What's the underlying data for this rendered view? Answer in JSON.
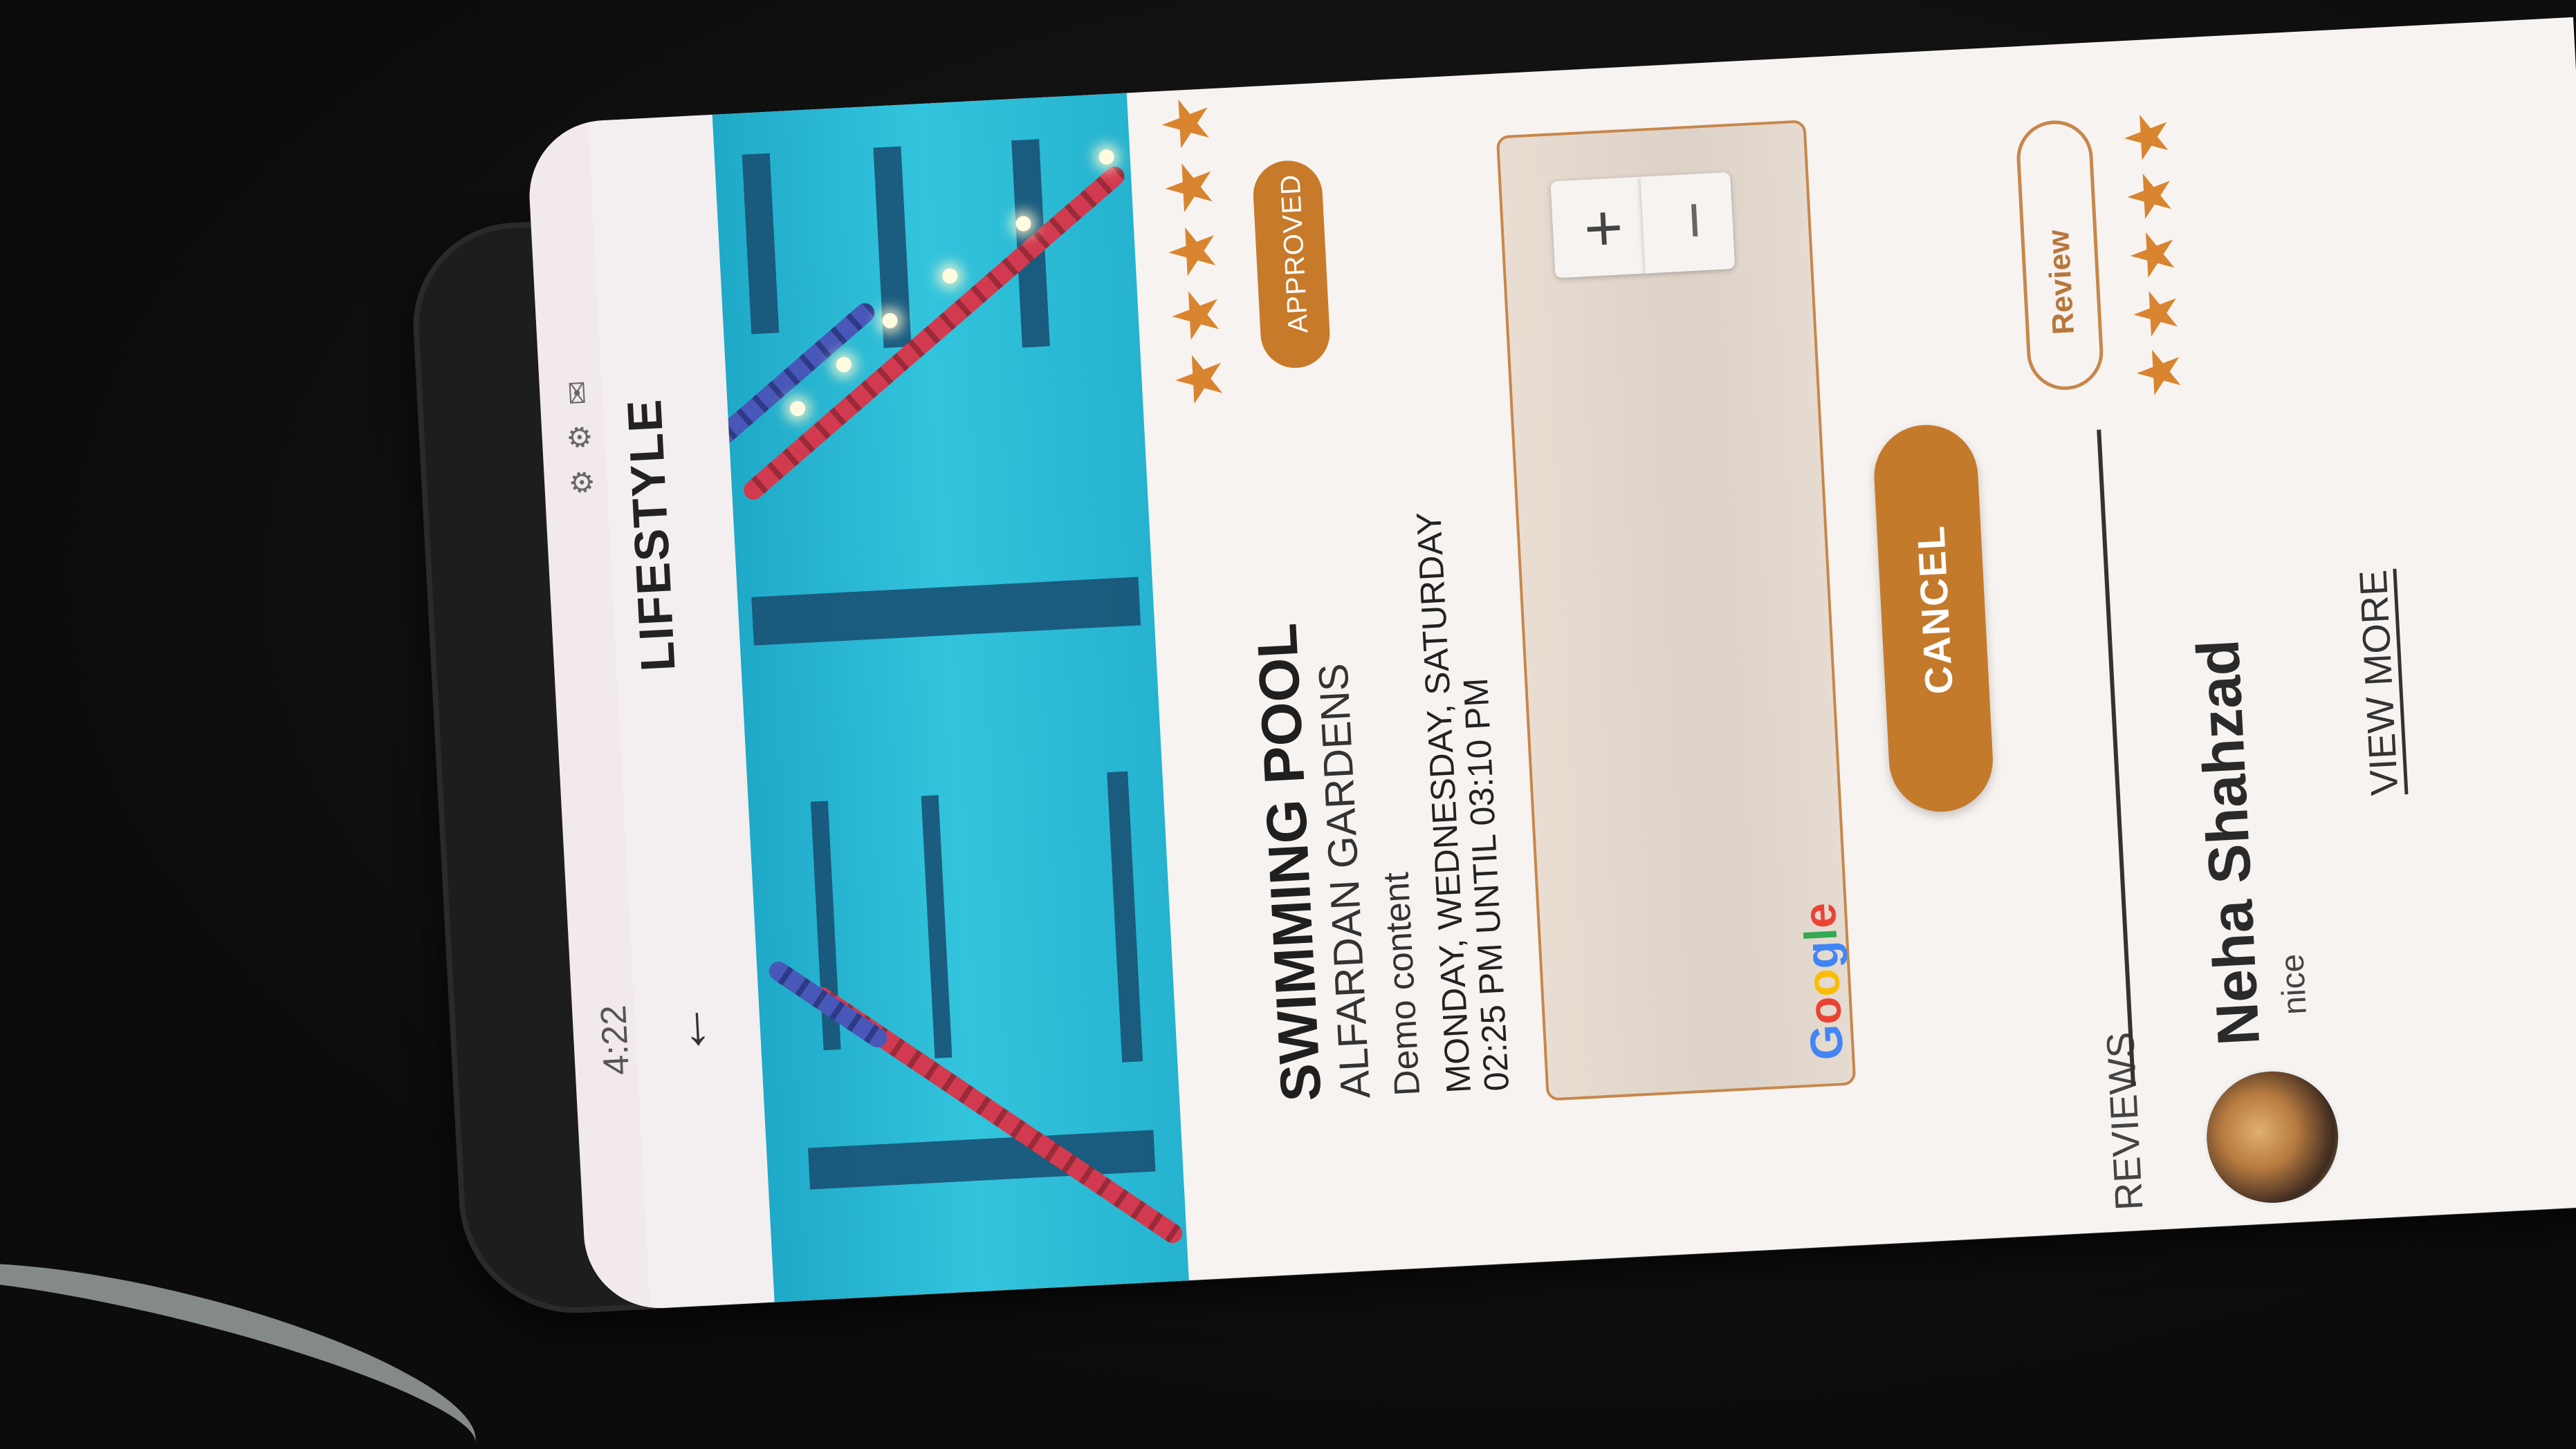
{
  "status_bar": {
    "time": "4:22",
    "icons": [
      "notification-icon",
      "notification-icon",
      "mail-icon",
      "wifi-icon",
      "signal-icon",
      "battery-icon"
    ]
  },
  "app_bar": {
    "back_icon": "back-arrow-icon",
    "title": "LIFESTYLE"
  },
  "hero_image": {
    "subject": "swimming-pool-image"
  },
  "facility": {
    "rating": 5,
    "stars": "★★★★★",
    "status_badge": "APPROVED",
    "name": "SWIMMING POOL",
    "location": "ALFARDAN GARDENS",
    "description": "Demo content",
    "schedule_days": "MONDAY, WEDNESDAY, SATURDAY",
    "schedule_time": "02:25 PM UNTIL 03:10 PM"
  },
  "map": {
    "zoom_in": "+",
    "zoom_out": "−",
    "provider": "Google"
  },
  "actions": {
    "cancel_label": "CANCEL",
    "review_label": "Review"
  },
  "reviews": {
    "title": "REVIEWS",
    "items": [
      {
        "name": "Neha Shahzad",
        "comment": "nice",
        "rating": 5,
        "stars": "★★★★★"
      }
    ],
    "view_more_label": "VIEW MORE"
  },
  "colors": {
    "accent": "#c47a2b",
    "star": "#d9842e",
    "pool": "#2bb8d4",
    "screen_bg": "#f7f3f1"
  }
}
